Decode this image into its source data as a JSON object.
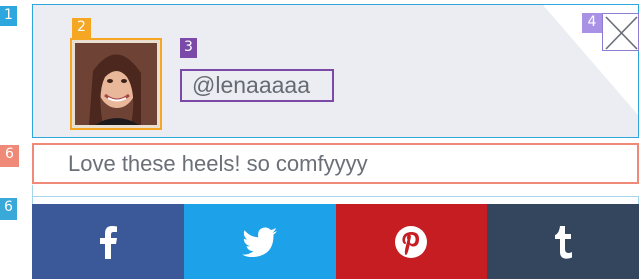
{
  "markers": [
    "1",
    "2",
    "3",
    "4",
    "6",
    "6"
  ],
  "profile": {
    "handle": "@lenaaaaa",
    "avatar_alt": "profile photo"
  },
  "comment": {
    "text": "Love these heels! so comfyyyy"
  },
  "share": {
    "buttons": [
      {
        "name": "facebook",
        "icon": "facebook-icon",
        "color": "#3b5998"
      },
      {
        "name": "twitter",
        "icon": "twitter-icon",
        "color": "#1da1e8"
      },
      {
        "name": "pinterest",
        "icon": "pinterest-icon",
        "color": "#c61d23"
      },
      {
        "name": "tumblr",
        "icon": "tumblr-icon",
        "color": "#34465d"
      }
    ]
  },
  "colors": {
    "marker_1": "#2ea6de",
    "marker_2": "#f5a623",
    "marker_3": "#7b4aa8",
    "marker_4": "#a992e6",
    "marker_6": "#f08a78",
    "marker_6b": "#39a9d9"
  }
}
